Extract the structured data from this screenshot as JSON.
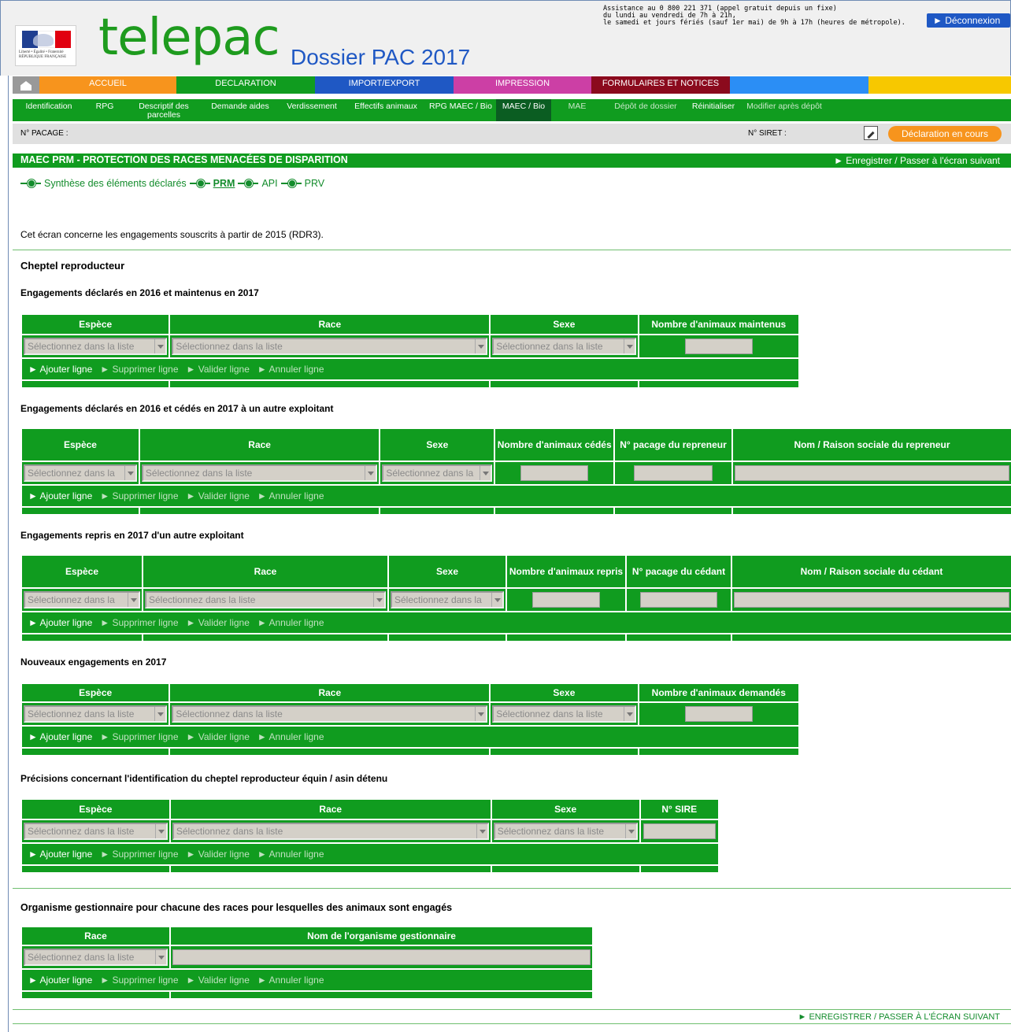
{
  "header": {
    "app_name": "telepac",
    "dossier_title": "Dossier PAC 2017",
    "flag_caption": "Liberté • Égalité • Fraternité RÉPUBLIQUE FRANÇAISE",
    "assistance_lines": [
      "Assistance au 0 800 221 371 (appel gratuit depuis un fixe)",
      "du lundi au vendredi de 7h à 21h,",
      "le samedi et jours fériés (sauf 1er mai) de 9h à 17h (heures de métropole)."
    ],
    "logout_label": "► Déconnexion"
  },
  "main_nav": [
    {
      "label": "ACCUEIL",
      "color": "#f7941d"
    },
    {
      "label": "DECLARATION",
      "color": "#109c1f"
    },
    {
      "label": "IMPORT/EXPORT",
      "color": "#1f58c4"
    },
    {
      "label": "IMPRESSION",
      "color": "#cc3fa5"
    },
    {
      "label": "FORMULAIRES ET NOTICES",
      "color": "#8b0a1d"
    },
    {
      "label": "",
      "color": "#2b8ef5"
    },
    {
      "label": "",
      "color": "#f7c800"
    }
  ],
  "sub_nav": [
    {
      "label": "Identification"
    },
    {
      "label": "RPG"
    },
    {
      "label": "Descriptif des parcelles"
    },
    {
      "label": "Demande aides"
    },
    {
      "label": "Verdissement"
    },
    {
      "label": "Effectifs animaux"
    },
    {
      "label": "RPG MAEC / Bio"
    },
    {
      "label": "MAEC / Bio",
      "active": true
    },
    {
      "label": "MAE"
    },
    {
      "label": "Dépôt de dossier"
    },
    {
      "label": "Réinitialiser"
    },
    {
      "label": "Modifier après dépôt"
    }
  ],
  "pacage_bar": {
    "pacage_label": "N° PACAGE :",
    "siret_label": "N° SIRET :",
    "status": "Déclaration en cours"
  },
  "section": {
    "title": "MAEC PRM - PROTECTION DES RACES MENACÉES DE DISPARITION",
    "next_label": "► Enregistrer / Passer à l'écran suivant"
  },
  "breadcrumb": [
    "Synthèse des éléments déclarés",
    "PRM",
    "API",
    "PRV"
  ],
  "intro": "Cet écran concerne les engagements souscrits à partir de 2015 (RDR3).",
  "cheptel_title": "Cheptel reproducteur",
  "select_placeholder": "Sélectionnez dans la liste",
  "select_placeholder_short": "Sélectionnez dans la",
  "select_placeholder_short2": "Sélectionnez dans l",
  "actions": {
    "add": "► Ajouter ligne",
    "delete": "► Supprimer ligne",
    "validate": "► Valider ligne",
    "cancel": "► Annuler ligne"
  },
  "tables": {
    "t1": {
      "title": "Engagements déclarés en 2016 et maintenus en 2017",
      "headers": [
        "Espèce",
        "Race",
        "Sexe",
        "Nombre d'animaux maintenus"
      ]
    },
    "t2": {
      "title": "Engagements déclarés en 2016 et cédés en 2017 à un autre exploitant",
      "headers": [
        "Espèce",
        "Race",
        "Sexe",
        "Nombre d'animaux cédés",
        "N° pacage du repreneur",
        "Nom / Raison sociale du repreneur"
      ]
    },
    "t3": {
      "title": "Engagements repris en 2017 d'un autre exploitant",
      "headers": [
        "Espèce",
        "Race",
        "Sexe",
        "Nombre d'animaux repris",
        "N° pacage du cédant",
        "Nom / Raison sociale du cédant"
      ]
    },
    "t4": {
      "title": "Nouveaux engagements en 2017",
      "headers": [
        "Espèce",
        "Race",
        "Sexe",
        "Nombre d'animaux demandés"
      ]
    },
    "t5": {
      "title": "Précisions concernant l'identification du cheptel reproducteur équin / asin détenu",
      "headers": [
        "Espèce",
        "Race",
        "Sexe",
        "N° SIRE"
      ]
    },
    "t6": {
      "title": "Organisme gestionnaire pour chacune des races pour lesquelles des animaux sont engagés",
      "headers": [
        "Race",
        "Nom de l'organisme gestionnaire"
      ]
    }
  },
  "bottom_next": "► ENREGISTRER / PASSER À L'ÉCRAN SUIVANT"
}
